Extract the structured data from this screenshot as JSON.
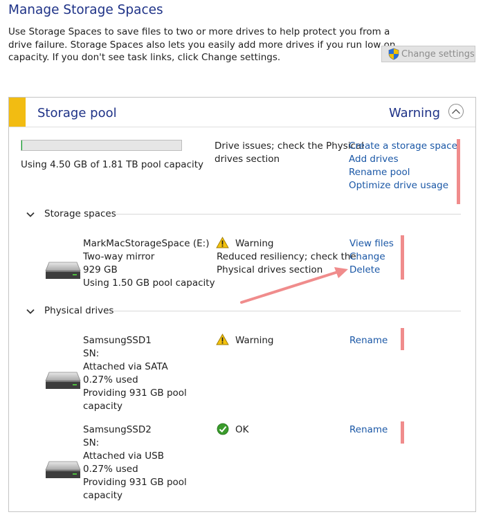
{
  "header": {
    "title": "Manage Storage Spaces",
    "intro_lines": [
      "Use Storage Spaces to save files to two or more drives to help protect you from a",
      "drive failure. Storage Spaces also lets you easily add more drives if you run low on",
      "capacity. If you don't see task links, click Change settings."
    ],
    "change_settings_label": "Change settings"
  },
  "pool": {
    "title": "Storage pool",
    "status": "Warning",
    "capacity_text": "Using 4.50 GB of 1.81 TB pool capacity",
    "used_fraction": 0.0024,
    "issue_lines": [
      "Drive issues; check the Physical",
      "drives section"
    ],
    "links": [
      "Create a storage space",
      "Add drives",
      "Rename pool",
      "Optimize drive usage"
    ]
  },
  "storage_spaces": {
    "label": "Storage spaces",
    "items": [
      {
        "lines": [
          "MarkMacStorageSpace (E:)",
          "Two-way mirror",
          "929 GB",
          "Using 1.50 GB pool capacity"
        ],
        "status": "Warning",
        "status_detail": [
          "Reduced resiliency; check the",
          "Physical drives section"
        ],
        "links": [
          "View files",
          "Change",
          "Delete"
        ]
      }
    ]
  },
  "physical_drives": {
    "label": "Physical drives",
    "items": [
      {
        "lines": [
          "SamsungSSD1",
          "SN:",
          "Attached via SATA",
          "0.27% used",
          "Providing 931 GB pool",
          "capacity"
        ],
        "status": "Warning",
        "link": "Rename"
      },
      {
        "lines": [
          "SamsungSSD2",
          "SN:",
          "Attached via USB",
          "0.27% used",
          "Providing 931 GB pool",
          "capacity"
        ],
        "status": "OK",
        "link": "Rename"
      }
    ]
  },
  "icons": {
    "shield": "shield-icon",
    "collapse": "chevron-up-icon",
    "section": "chevron-down-icon",
    "drive": "hard-drive-icon",
    "warning": "warning-icon",
    "ok": "check-icon"
  },
  "colors": {
    "title": "#1e3287",
    "link": "#1a57a6",
    "pool_stripe": "#f2bc12",
    "annotation": "#f08c8c",
    "warning": "#f4c20d",
    "ok": "#3a9b2c"
  }
}
